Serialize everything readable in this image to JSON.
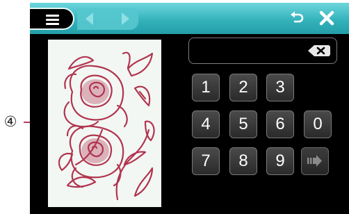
{
  "callout": {
    "label": "④"
  },
  "toolbar": {
    "menu_icon": "hamburger-menu-icon",
    "prev_icon": "arrow-left-icon",
    "next_icon": "arrow-right-icon",
    "undo_icon": "undo-icon",
    "close_icon": "close-icon"
  },
  "preview": {
    "design": "rose embroidery pattern",
    "thread_color": "#b2344f"
  },
  "entry": {
    "value": "",
    "backspace_icon": "backspace-icon"
  },
  "keypad": {
    "keys": [
      "1",
      "2",
      "3",
      "4",
      "5",
      "6",
      "0",
      "7",
      "8",
      "9"
    ],
    "enter_icon": "set-arrow-icon"
  },
  "colors": {
    "accent": "#34b3bd",
    "background": "#000000",
    "callout_line": "#b23a6a"
  }
}
